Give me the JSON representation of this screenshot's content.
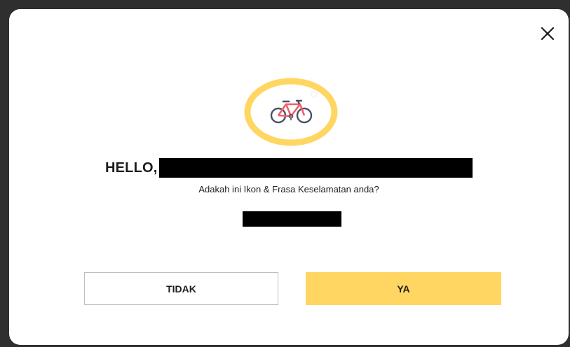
{
  "dialog": {
    "close_icon": "close-icon",
    "safety_icon": "bicycle-icon",
    "greeting": "HELLO,",
    "question": "Adakah ini Ikon & Frasa Keselamatan anda?",
    "buttons": {
      "no_label": "TIDAK",
      "yes_label": "YA"
    }
  },
  "colors": {
    "accent": "#ffd661",
    "ring": "#ffd661",
    "bicycle_frame": "#f0606a",
    "bicycle_wheels": "#4a4f66",
    "redaction": "#000000"
  }
}
